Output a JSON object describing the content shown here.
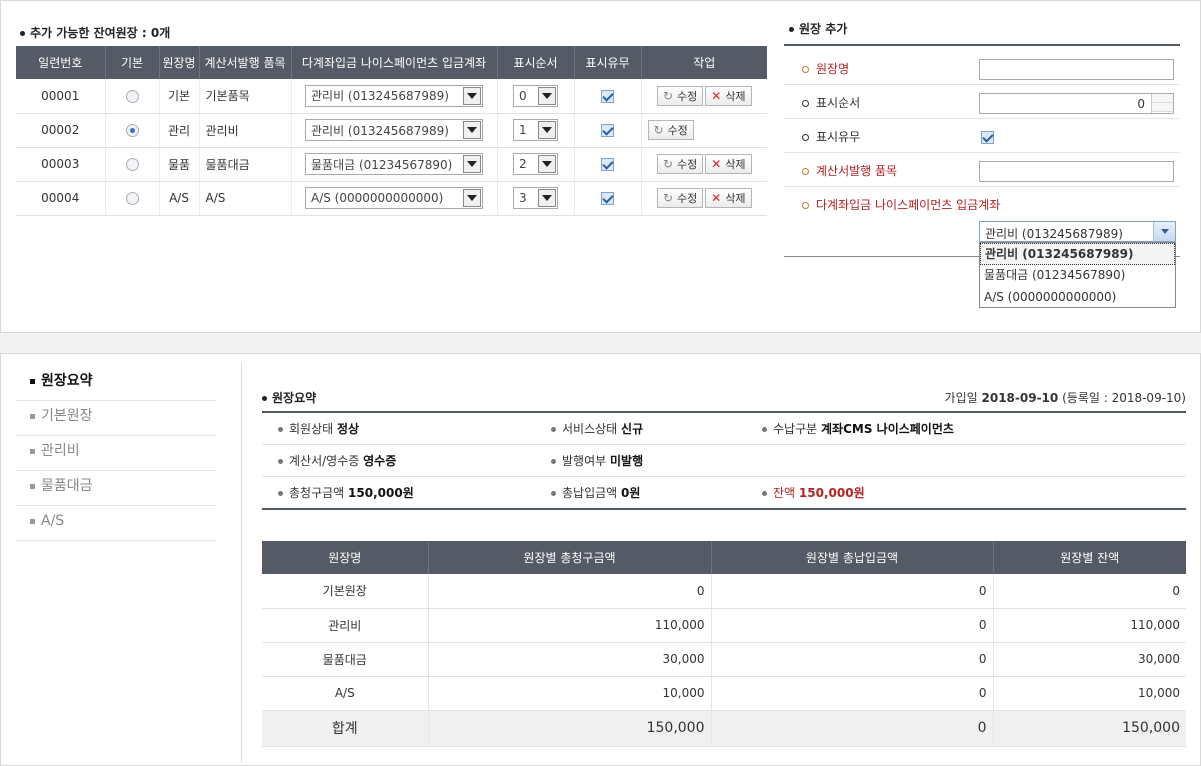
{
  "top": {
    "title": "추가 가능한 잔여원장 : 0개",
    "columns": [
      "일련번호",
      "기본",
      "원장명",
      "계산서발행 품목",
      "다계좌입금 나이스페이먼츠 입금계좌",
      "표시순서",
      "표시유무",
      "작업"
    ],
    "rows": [
      {
        "serial": "00001",
        "is_default": false,
        "name": "기본",
        "item": "기본품목",
        "account": "관리비 (013245687989)",
        "order": "0",
        "visible": true,
        "edit": "수정",
        "del": "삭제"
      },
      {
        "serial": "00002",
        "is_default": true,
        "name": "관리",
        "item": "관리비",
        "account": "관리비 (013245687989)",
        "order": "1",
        "visible": true,
        "edit": "수정",
        "del": ""
      },
      {
        "serial": "00003",
        "is_default": false,
        "name": "물품",
        "item": "물품대금",
        "account": "물품대금 (01234567890)",
        "order": "2",
        "visible": true,
        "edit": "수정",
        "del": "삭제"
      },
      {
        "serial": "00004",
        "is_default": false,
        "name": "A/S",
        "item": "A/S",
        "account": "A/S (0000000000000)",
        "order": "3",
        "visible": true,
        "edit": "수정",
        "del": "삭제"
      }
    ]
  },
  "add_form": {
    "title": "원장 추가",
    "name_label": "원장명",
    "order_label": "표시순서",
    "order_value": "0",
    "visible_label": "표시유무",
    "item_label": "계산서발행 품목",
    "account_label": "다계좌입금 나이스페이먼츠 입금계좌",
    "account_selected": "관리비 (013245687989)",
    "account_options": [
      "관리비 (013245687989)",
      "물품대금 (01234567890)",
      "A/S (0000000000000)"
    ]
  },
  "nav": {
    "items": [
      "원장요약",
      "기본원장",
      "관리비",
      "물품대금",
      "A/S"
    ]
  },
  "summary": {
    "title": "원장요약",
    "join_label": "가입일",
    "join_date": "2018-09-10",
    "reg_text": "(등록일 : 2018-09-10)",
    "member_status_label": "회원상태",
    "member_status": "정상",
    "service_status_label": "서비스상태",
    "service_status": "신규",
    "payment_label": "수납구분",
    "payment": "계좌CMS 나이스페이먼츠",
    "receipt_label": "계산서/영수증",
    "receipt": "영수증",
    "issued_label": "발행여부",
    "issued": "미발행",
    "billed_label": "총청구금액",
    "billed": "150,000원",
    "paid_label": "총납입금액",
    "paid": "0원",
    "balance_label": "잔액",
    "balance": "150,000원"
  },
  "summary_table": {
    "columns": [
      "원장명",
      "원장별 총청구금액",
      "원장별 총납입금액",
      "원장별 잔액"
    ],
    "rows": [
      {
        "name": "기본원장",
        "billed": "0",
        "paid": "0",
        "balance": "0"
      },
      {
        "name": "관리비",
        "billed": "110,000",
        "paid": "0",
        "balance": "110,000"
      },
      {
        "name": "물품대금",
        "billed": "30,000",
        "paid": "0",
        "balance": "30,000"
      },
      {
        "name": "A/S",
        "billed": "10,000",
        "paid": "0",
        "balance": "10,000"
      }
    ],
    "total": {
      "name": "합계",
      "billed": "150,000",
      "paid": "0",
      "balance": "150,000"
    }
  }
}
